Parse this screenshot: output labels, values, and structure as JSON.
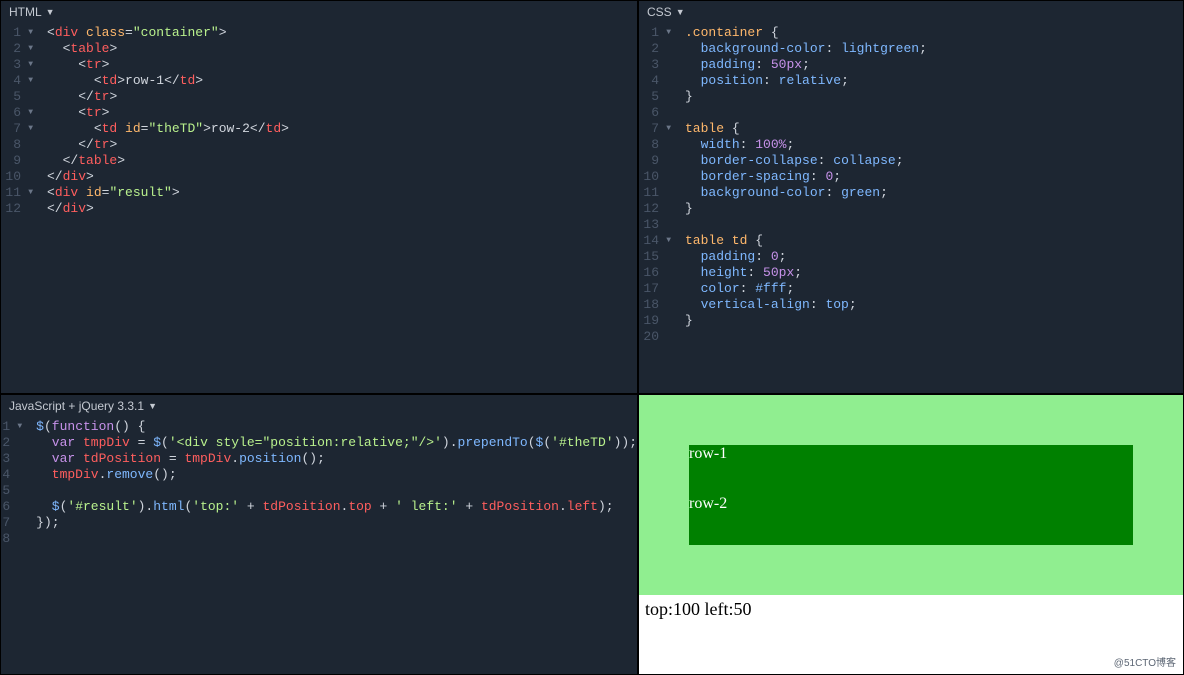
{
  "panels": {
    "html": {
      "title": "HTML"
    },
    "css": {
      "title": "CSS"
    },
    "js": {
      "title": "JavaScript + jQuery 3.3.1"
    }
  },
  "html_code": [
    {
      "n": "1",
      "f": true,
      "tokens": [
        [
          "punc",
          "<"
        ],
        [
          "tag",
          "div"
        ],
        [
          "text",
          " "
        ],
        [
          "attr",
          "class"
        ],
        [
          "punc",
          "="
        ],
        [
          "str",
          "\"container\""
        ],
        [
          "punc",
          ">"
        ]
      ]
    },
    {
      "n": "2",
      "f": true,
      "tokens": [
        [
          "text",
          "  "
        ],
        [
          "punc",
          "<"
        ],
        [
          "tag",
          "table"
        ],
        [
          "punc",
          ">"
        ]
      ]
    },
    {
      "n": "3",
      "f": true,
      "tokens": [
        [
          "text",
          "    "
        ],
        [
          "punc",
          "<"
        ],
        [
          "tag",
          "tr"
        ],
        [
          "punc",
          ">"
        ]
      ]
    },
    {
      "n": "4",
      "f": true,
      "tokens": [
        [
          "text",
          "      "
        ],
        [
          "punc",
          "<"
        ],
        [
          "tag",
          "td"
        ],
        [
          "punc",
          ">"
        ],
        [
          "text",
          "row-1"
        ],
        [
          "punc",
          "</"
        ],
        [
          "tag",
          "td"
        ],
        [
          "punc",
          ">"
        ]
      ]
    },
    {
      "n": "5",
      "tokens": [
        [
          "text",
          "    "
        ],
        [
          "punc",
          "</"
        ],
        [
          "tag",
          "tr"
        ],
        [
          "punc",
          ">"
        ]
      ]
    },
    {
      "n": "6",
      "f": true,
      "tokens": [
        [
          "text",
          "    "
        ],
        [
          "punc",
          "<"
        ],
        [
          "tag",
          "tr"
        ],
        [
          "punc",
          ">"
        ]
      ]
    },
    {
      "n": "7",
      "f": true,
      "tokens": [
        [
          "text",
          "      "
        ],
        [
          "punc",
          "<"
        ],
        [
          "tag",
          "td"
        ],
        [
          "text",
          " "
        ],
        [
          "attr",
          "id"
        ],
        [
          "punc",
          "="
        ],
        [
          "str",
          "\"theTD\""
        ],
        [
          "punc",
          ">"
        ],
        [
          "text",
          "row-2"
        ],
        [
          "punc",
          "</"
        ],
        [
          "tag",
          "td"
        ],
        [
          "punc",
          ">"
        ]
      ]
    },
    {
      "n": "8",
      "tokens": [
        [
          "text",
          "    "
        ],
        [
          "punc",
          "</"
        ],
        [
          "tag",
          "tr"
        ],
        [
          "punc",
          ">"
        ]
      ]
    },
    {
      "n": "9",
      "tokens": [
        [
          "text",
          "  "
        ],
        [
          "punc",
          "</"
        ],
        [
          "tag",
          "table"
        ],
        [
          "punc",
          ">"
        ]
      ]
    },
    {
      "n": "10",
      "tokens": [
        [
          "punc",
          "</"
        ],
        [
          "tag",
          "div"
        ],
        [
          "punc",
          ">"
        ]
      ]
    },
    {
      "n": "11",
      "f": true,
      "tokens": [
        [
          "punc",
          "<"
        ],
        [
          "tag",
          "div"
        ],
        [
          "text",
          " "
        ],
        [
          "attr",
          "id"
        ],
        [
          "punc",
          "="
        ],
        [
          "str",
          "\"result\""
        ],
        [
          "punc",
          ">"
        ]
      ]
    },
    {
      "n": "12",
      "tokens": [
        [
          "punc",
          "</"
        ],
        [
          "tag",
          "div"
        ],
        [
          "punc",
          ">"
        ]
      ]
    }
  ],
  "css_code": [
    {
      "n": "1",
      "f": true,
      "tokens": [
        [
          "sel",
          ".container"
        ],
        [
          "text",
          " "
        ],
        [
          "punc",
          "{"
        ]
      ]
    },
    {
      "n": "2",
      "tokens": [
        [
          "text",
          "  "
        ],
        [
          "prop",
          "background-color"
        ],
        [
          "punc",
          ":"
        ],
        [
          "text",
          " "
        ],
        [
          "val",
          "lightgreen"
        ],
        [
          "punc",
          ";"
        ]
      ]
    },
    {
      "n": "3",
      "tokens": [
        [
          "text",
          "  "
        ],
        [
          "prop",
          "padding"
        ],
        [
          "punc",
          ":"
        ],
        [
          "text",
          " "
        ],
        [
          "num",
          "50px"
        ],
        [
          "punc",
          ";"
        ]
      ]
    },
    {
      "n": "4",
      "tokens": [
        [
          "text",
          "  "
        ],
        [
          "prop",
          "position"
        ],
        [
          "punc",
          ":"
        ],
        [
          "text",
          " "
        ],
        [
          "val",
          "relative"
        ],
        [
          "punc",
          ";"
        ]
      ]
    },
    {
      "n": "5",
      "tokens": [
        [
          "punc",
          "}"
        ]
      ]
    },
    {
      "n": "6",
      "tokens": []
    },
    {
      "n": "7",
      "f": true,
      "tokens": [
        [
          "sel",
          "table"
        ],
        [
          "text",
          " "
        ],
        [
          "punc",
          "{"
        ]
      ]
    },
    {
      "n": "8",
      "tokens": [
        [
          "text",
          "  "
        ],
        [
          "prop",
          "width"
        ],
        [
          "punc",
          ":"
        ],
        [
          "text",
          " "
        ],
        [
          "num",
          "100%"
        ],
        [
          "punc",
          ";"
        ]
      ]
    },
    {
      "n": "9",
      "tokens": [
        [
          "text",
          "  "
        ],
        [
          "prop",
          "border-collapse"
        ],
        [
          "punc",
          ":"
        ],
        [
          "text",
          " "
        ],
        [
          "val",
          "collapse"
        ],
        [
          "punc",
          ";"
        ]
      ]
    },
    {
      "n": "10",
      "tokens": [
        [
          "text",
          "  "
        ],
        [
          "prop",
          "border-spacing"
        ],
        [
          "punc",
          ":"
        ],
        [
          "text",
          " "
        ],
        [
          "num",
          "0"
        ],
        [
          "punc",
          ";"
        ]
      ]
    },
    {
      "n": "11",
      "tokens": [
        [
          "text",
          "  "
        ],
        [
          "prop",
          "background-color"
        ],
        [
          "punc",
          ":"
        ],
        [
          "text",
          " "
        ],
        [
          "val",
          "green"
        ],
        [
          "punc",
          ";"
        ]
      ]
    },
    {
      "n": "12",
      "tokens": [
        [
          "punc",
          "}"
        ]
      ]
    },
    {
      "n": "13",
      "tokens": []
    },
    {
      "n": "14",
      "f": true,
      "tokens": [
        [
          "sel",
          "table td"
        ],
        [
          "text",
          " "
        ],
        [
          "punc",
          "{"
        ]
      ]
    },
    {
      "n": "15",
      "tokens": [
        [
          "text",
          "  "
        ],
        [
          "prop",
          "padding"
        ],
        [
          "punc",
          ":"
        ],
        [
          "text",
          " "
        ],
        [
          "num",
          "0"
        ],
        [
          "punc",
          ";"
        ]
      ]
    },
    {
      "n": "16",
      "tokens": [
        [
          "text",
          "  "
        ],
        [
          "prop",
          "height"
        ],
        [
          "punc",
          ":"
        ],
        [
          "text",
          " "
        ],
        [
          "num",
          "50px"
        ],
        [
          "punc",
          ";"
        ]
      ]
    },
    {
      "n": "17",
      "tokens": [
        [
          "text",
          "  "
        ],
        [
          "prop",
          "color"
        ],
        [
          "punc",
          ":"
        ],
        [
          "text",
          " "
        ],
        [
          "val",
          "#fff"
        ],
        [
          "punc",
          ";"
        ]
      ]
    },
    {
      "n": "18",
      "tokens": [
        [
          "text",
          "  "
        ],
        [
          "prop",
          "vertical-align"
        ],
        [
          "punc",
          ":"
        ],
        [
          "text",
          " "
        ],
        [
          "val",
          "top"
        ],
        [
          "punc",
          ";"
        ]
      ]
    },
    {
      "n": "19",
      "tokens": [
        [
          "punc",
          "}"
        ]
      ]
    },
    {
      "n": "20",
      "tokens": []
    }
  ],
  "js_code": [
    {
      "n": "1",
      "f": true,
      "tokens": [
        [
          "js-fn",
          "$"
        ],
        [
          "punc",
          "("
        ],
        [
          "js-var",
          "function"
        ],
        [
          "punc",
          "() {"
        ]
      ]
    },
    {
      "n": "2",
      "tokens": [
        [
          "text",
          "  "
        ],
        [
          "js-var",
          "var"
        ],
        [
          "text",
          " "
        ],
        [
          "js-name",
          "tmpDiv"
        ],
        [
          "text",
          " "
        ],
        [
          "punc",
          "= "
        ],
        [
          "js-fn",
          "$"
        ],
        [
          "punc",
          "("
        ],
        [
          "js-str",
          "'<div style=\"position:relative;\"/>'"
        ],
        [
          "punc",
          ")."
        ],
        [
          "js-fn",
          "prependTo"
        ],
        [
          "punc",
          "("
        ],
        [
          "js-fn",
          "$"
        ],
        [
          "punc",
          "("
        ],
        [
          "js-str",
          "'#theTD'"
        ],
        [
          "punc",
          "));"
        ]
      ]
    },
    {
      "n": "3",
      "tokens": [
        [
          "text",
          "  "
        ],
        [
          "js-var",
          "var"
        ],
        [
          "text",
          " "
        ],
        [
          "js-name",
          "tdPosition"
        ],
        [
          "text",
          " "
        ],
        [
          "punc",
          "= "
        ],
        [
          "js-name",
          "tmpDiv"
        ],
        [
          "punc",
          "."
        ],
        [
          "js-fn",
          "position"
        ],
        [
          "punc",
          "();"
        ]
      ]
    },
    {
      "n": "4",
      "tokens": [
        [
          "text",
          "  "
        ],
        [
          "js-name",
          "tmpDiv"
        ],
        [
          "punc",
          "."
        ],
        [
          "js-fn",
          "remove"
        ],
        [
          "punc",
          "();"
        ]
      ]
    },
    {
      "n": "5",
      "tokens": []
    },
    {
      "n": "6",
      "tokens": [
        [
          "text",
          "  "
        ],
        [
          "js-fn",
          "$"
        ],
        [
          "punc",
          "("
        ],
        [
          "js-str",
          "'#result'"
        ],
        [
          "punc",
          ")."
        ],
        [
          "js-fn",
          "html"
        ],
        [
          "punc",
          "("
        ],
        [
          "js-str",
          "'top:'"
        ],
        [
          "punc",
          " + "
        ],
        [
          "js-name",
          "tdPosition"
        ],
        [
          "punc",
          "."
        ],
        [
          "js-name",
          "top"
        ],
        [
          "punc",
          " + "
        ],
        [
          "js-str",
          "' left:'"
        ],
        [
          "punc",
          " + "
        ],
        [
          "js-name",
          "tdPosition"
        ],
        [
          "punc",
          "."
        ],
        [
          "js-name",
          "left"
        ],
        [
          "punc",
          ");"
        ]
      ]
    },
    {
      "n": "7",
      "tokens": [
        [
          "punc",
          "});"
        ]
      ]
    },
    {
      "n": "8",
      "tokens": []
    }
  ],
  "preview": {
    "row1": "row-1",
    "row2": "row-2",
    "result": "top:100 left:50"
  },
  "watermark": "@51CTO博客"
}
